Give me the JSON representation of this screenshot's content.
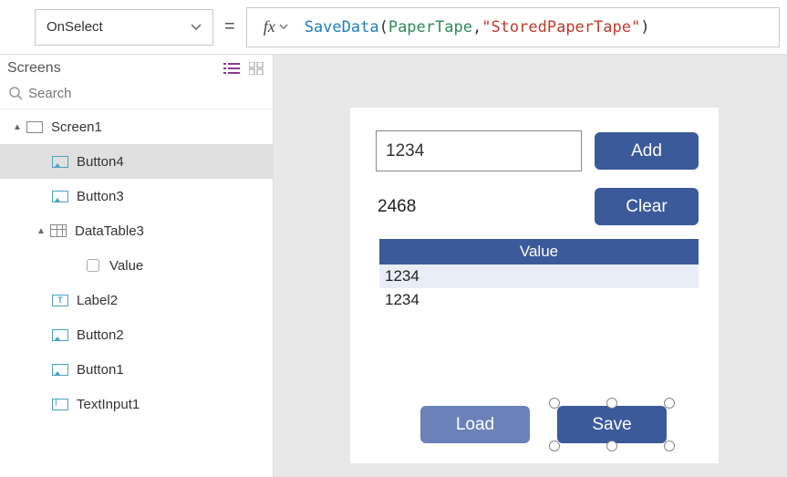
{
  "formula_bar": {
    "property": "OnSelect",
    "fx_label": "fx",
    "tokens": {
      "func": "SaveData",
      "open": "( ",
      "ident": "PaperTape",
      "comma": ", ",
      "str": "\"StoredPaperTape\"",
      "close": " )"
    }
  },
  "left_panel": {
    "title": "Screens",
    "search_placeholder": "Search"
  },
  "tree": {
    "screen1": "Screen1",
    "button4": "Button4",
    "button3": "Button3",
    "datatable3": "DataTable3",
    "value_col": "Value",
    "label2": "Label2",
    "button2": "Button2",
    "button1": "Button1",
    "textinput1": "TextInput1"
  },
  "app": {
    "input_value": "1234",
    "add_label": "Add",
    "sum_value": "2468",
    "clear_label": "Clear",
    "table_header": "Value",
    "rows": [
      "1234",
      "1234"
    ],
    "load_label": "Load",
    "save_label": "Save"
  }
}
